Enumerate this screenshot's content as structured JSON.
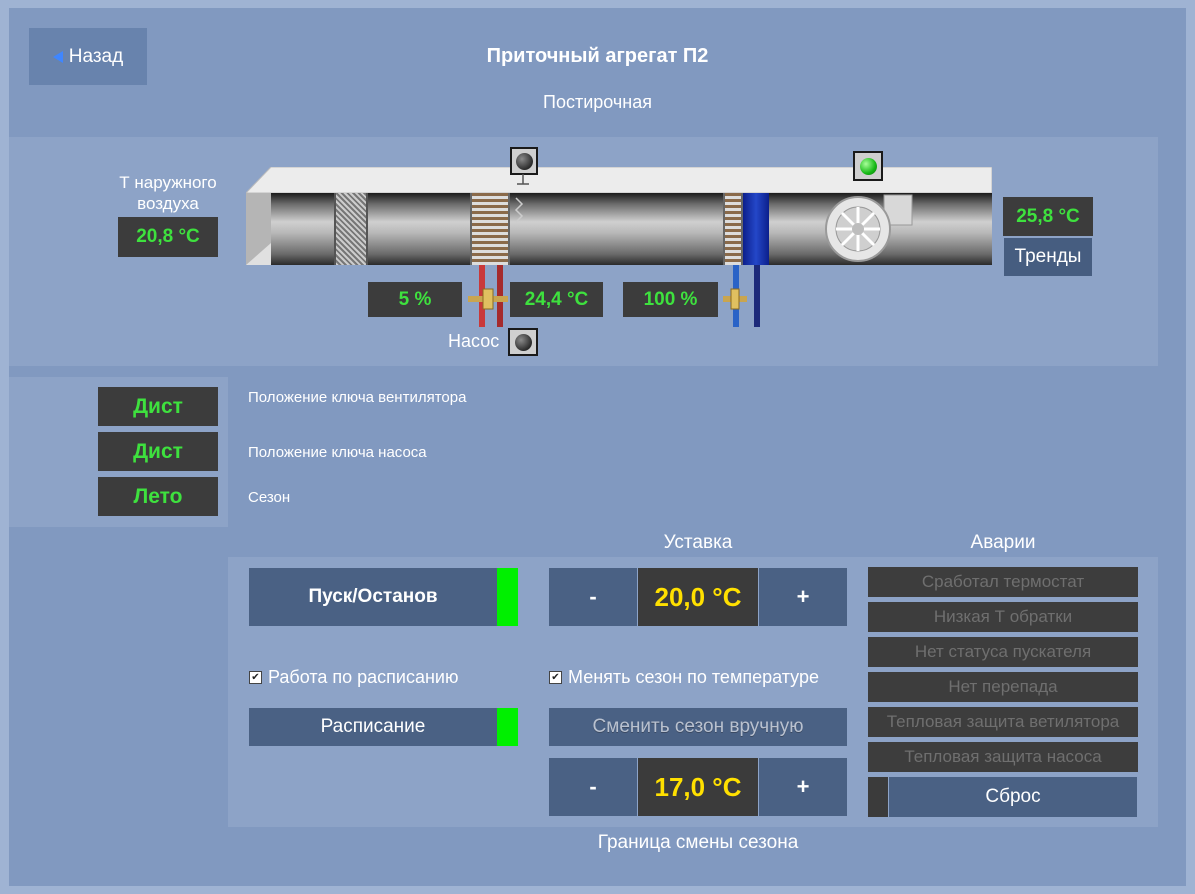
{
  "header": {
    "back_label": "Назад",
    "title": "Приточный агрегат П2",
    "subtitle": "Постирочная"
  },
  "scheme": {
    "outdoor_label": "Т наружного воздуха",
    "outdoor_temp": "20,8 °C",
    "supply_temp": "25,8 °C",
    "trends_label": "Тренды",
    "heating_valve": "5 %",
    "return_water_temp": "24,4 °C",
    "cooling_valve": "100 %",
    "pump_label": "Насос",
    "pump_lamp_state": "off",
    "heater_lamp_state": "off",
    "fan_lamp_state": "on",
    "colors": {
      "value_green": "#3ee13e",
      "lamp_on": "#15b815"
    }
  },
  "status": {
    "items": [
      {
        "value": "Дист",
        "label": "Положение ключа вентилятора"
      },
      {
        "value": "Дист",
        "label": "Положение ключа насоса"
      },
      {
        "value": "Лето",
        "label": "Сезон"
      }
    ]
  },
  "control": {
    "setpoint_header": "Уставка",
    "alarms_header": "Аварии",
    "start_stop_label": "Пуск/Останов",
    "start_stop_active": true,
    "schedule_check_label": "Работа по расписанию",
    "schedule_checked": true,
    "schedule_button_label": "Расписание",
    "schedule_active": true,
    "setpoint_minus": "-",
    "setpoint_value": "20,0 °C",
    "setpoint_plus": "+",
    "season_check_label": "Менять сезон по температуре",
    "season_checked": true,
    "season_manual_label": "Сменить сезон вручную",
    "border_minus": "-",
    "border_value": "17,0 °C",
    "border_plus": "+",
    "border_label": "Граница смены сезона",
    "check_mark": "✔",
    "colors": {
      "setpoint_yellow": "#ffe000",
      "indicator_green": "#00f000"
    }
  },
  "alarms": {
    "items": [
      "Сработал термостат",
      "Низкая Т обратки",
      "Нет статуса пускателя",
      "Нет перепада",
      "Тепловая защита ветилятора",
      "Тепловая защита насоса"
    ],
    "reset_label": "Сброс"
  }
}
